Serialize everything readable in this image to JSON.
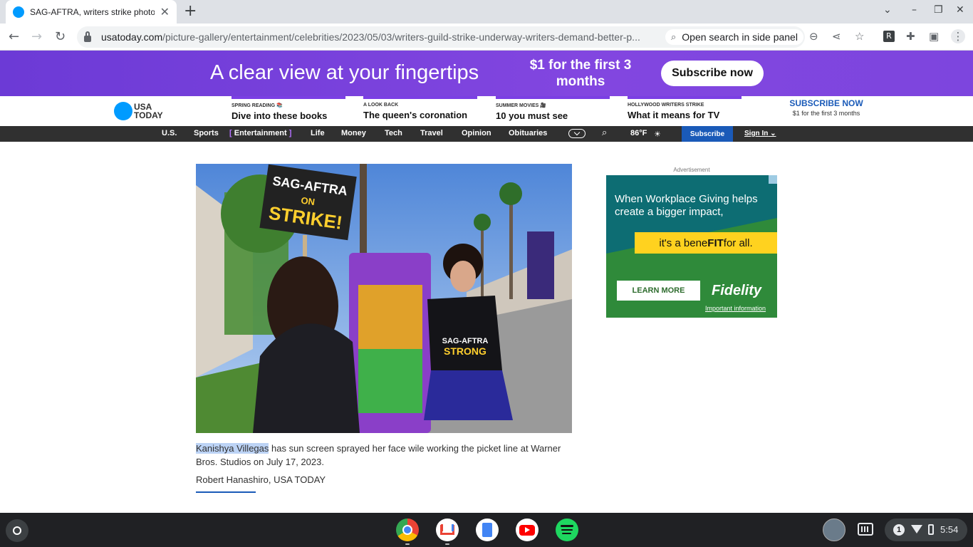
{
  "browser": {
    "tab_title": "SAG-AFTRA, writers strike photos",
    "tab_close": "✕",
    "new_tab": "+",
    "window_controls": [
      "⌄",
      "–",
      "❐",
      "✕"
    ],
    "url_host": "usatoday.com",
    "url_path": "/picture-gallery/entertainment/celebrities/2023/05/03/writers-guild-strike-underway-writers-demand-better-p...",
    "side_search_label": "Open search in side panel",
    "icons": [
      "back-icon",
      "forward-icon",
      "reload-icon",
      "lock-icon",
      "zoom-icon",
      "share-icon",
      "star-icon",
      "extension-r-icon",
      "puzzle-icon",
      "side-panel-icon",
      "menu-icon"
    ]
  },
  "banner": {
    "headline": "A clear view at your fingertips",
    "offer": "$1 for the first 3 months",
    "button": "Subscribe now"
  },
  "site_header": {
    "logo_line1": "USA",
    "logo_line2": "TODAY",
    "promos": [
      {
        "kicker": "SPRING READING 📚",
        "title": "Dive into these books"
      },
      {
        "kicker": "A LOOK BACK",
        "title": "The queen's coronation"
      },
      {
        "kicker": "SUMMER MOVIES 🎥",
        "title": "10 you must see"
      },
      {
        "kicker": "HOLLYWOOD WRITERS STRIKE",
        "title": "What it means for TV"
      }
    ],
    "subscribe_title": "SUBSCRIBE NOW",
    "subscribe_note": "$1 for the first 3 months"
  },
  "nav": {
    "items": [
      "U.S.",
      "Sports",
      "Entertainment",
      "Life",
      "Money",
      "Tech",
      "Travel",
      "Opinion",
      "Obituaries"
    ],
    "active": "Entertainment",
    "weather": "86°F",
    "subscribe": "Subscribe",
    "signin": "Sign In"
  },
  "photo": {
    "sign_line1": "SAG-AFTRA",
    "sign_line2": "ON",
    "sign_line3": "STRIKE!",
    "shirt_line1": "SAG-AFTRA",
    "shirt_line2": "STRONG"
  },
  "article": {
    "caption_name": "Kanishya Villegas",
    "caption_rest": " has sun screen sprayed her face wile working the picket line at Warner Bros. Studios on July 17, 2023.",
    "credit": "Robert Hanashiro, USA TODAY"
  },
  "ad": {
    "label": "Advertisement",
    "headline": "When Workplace Giving helps create a bigger impact,",
    "tagline_pre": "it's a bene",
    "tagline_bold": "FIT",
    "tagline_post": " for all.",
    "button": "LEARN MORE",
    "brand": "Fidelity",
    "info": "Important information"
  },
  "taskbar": {
    "apps": [
      "chrome-icon",
      "gmail-icon",
      "docs-icon",
      "youtube-icon",
      "spotify-icon"
    ],
    "notification_count": "1",
    "time": "5:54"
  },
  "colors": {
    "banner_purple": "#7b3fe4",
    "usat_blue": "#009bff",
    "subscribe_blue": "#1a5ab8",
    "nav_dark": "#303030",
    "ad_yellow": "#ffd21f"
  }
}
